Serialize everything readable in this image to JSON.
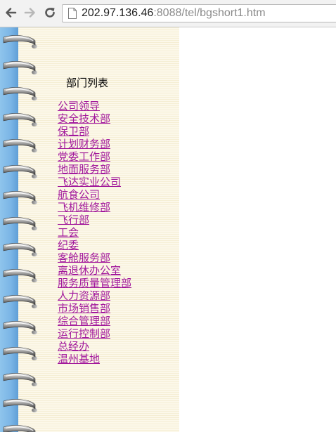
{
  "browser": {
    "url_host": "202.97.136.46",
    "url_rest": ":8088/tel/bgshort1.htm"
  },
  "page": {
    "title": "部门列表",
    "departments": [
      "公司领导",
      "安全技术部",
      "保卫部",
      "计划财务部",
      "党委工作部",
      "地面服务部",
      "飞达实业公司",
      "航食公司",
      "飞机维修部",
      "飞行部",
      "工会",
      "纪委",
      "客舱服务部",
      "离退休办公室",
      "服务质量管理部",
      "人力资源部",
      "市场销售部",
      "综合管理部",
      "运行控制部",
      "总经办",
      "温州基地"
    ]
  },
  "colors": {
    "link": "#a2189c",
    "paper": "#fbf6e6",
    "binding_edge": "#7ab5e6"
  }
}
